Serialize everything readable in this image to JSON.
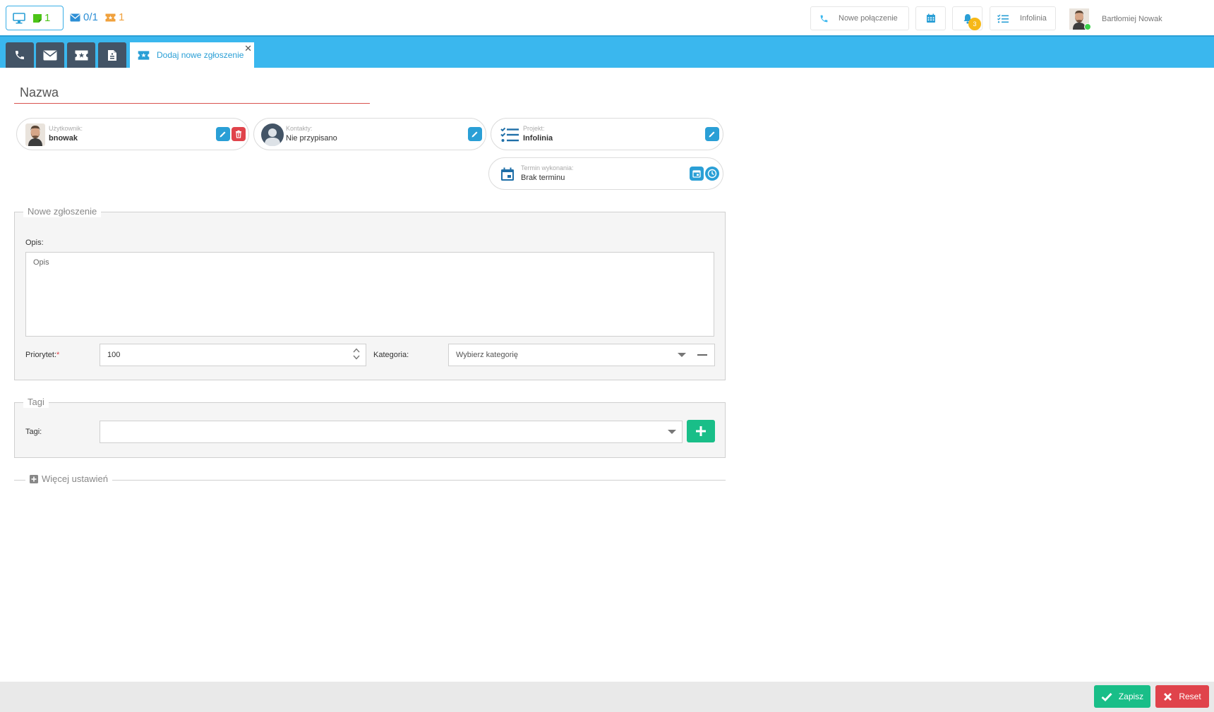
{
  "colors": {
    "accent_blue": "#2a9fd6",
    "tabbar_blue": "#3ab7ee",
    "dark_slate": "#435466",
    "green": "#19be88",
    "red": "#e0434b",
    "warning": "#f6b817"
  },
  "topbar": {
    "status": {
      "monitor_icon": "monitor-icon",
      "chat_count": "1"
    },
    "mail_count": "0/1",
    "ticket_count": "1",
    "new_call_label": "Nowe połączenie",
    "notifications_count": "3",
    "project_label": "Infolinia",
    "user_name": "Bartłomiej Nowak"
  },
  "tabs": {
    "icons": [
      "phone-icon",
      "envelope-icon",
      "ticket-icon",
      "document-icon"
    ],
    "active_label": "Dodaj nowe zgłoszenie",
    "close_symbol": "✕"
  },
  "form": {
    "name_placeholder": "Nazwa",
    "user": {
      "label": "Użytkownik:",
      "value": "bnowak"
    },
    "contacts": {
      "label": "Kontakty:",
      "value": "Nie przypisano"
    },
    "project": {
      "label": "Projekt:",
      "value": "Infolinia"
    },
    "deadline": {
      "label": "Termin wykonania:",
      "value": "Brak terminu"
    }
  },
  "new_ticket": {
    "legend": "Nowe zgłoszenie",
    "description_label": "Opis:",
    "description_placeholder": "Opis",
    "priority_label": "Priorytet:",
    "priority_required": "*",
    "priority_value": "100",
    "category_label": "Kategoria:",
    "category_placeholder": "Wybierz kategorię"
  },
  "tags": {
    "legend": "Tagi",
    "label": "Tagi:",
    "value": ""
  },
  "more_settings_label": "Więcej ustawień",
  "footer": {
    "save_label": "Zapisz",
    "reset_label": "Reset"
  }
}
